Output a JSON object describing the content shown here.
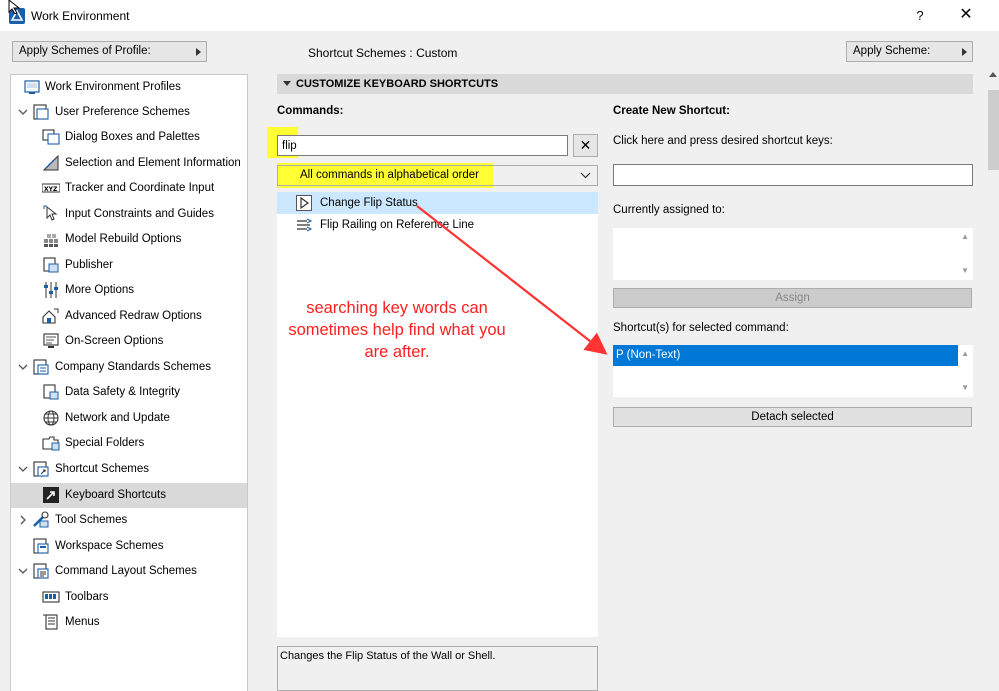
{
  "window": {
    "title": "Work Environment",
    "help": "?",
    "close": "✕"
  },
  "topbar": {
    "profile_button": "Apply Schemes of Profile:",
    "scheme_label": "Shortcut Schemes :",
    "scheme_value": "Custom",
    "apply_scheme_button": "Apply Scheme:"
  },
  "tree": {
    "items": [
      {
        "label": "Work Environment Profiles",
        "icon": "profiles-icon",
        "level": 0
      },
      {
        "label": "User Preference Schemes",
        "icon": "user-preference-icon",
        "level": 0,
        "expanded": true
      },
      {
        "label": "Dialog Boxes and Palettes",
        "icon": "dialog-boxes-icon",
        "level": 1
      },
      {
        "label": "Selection and Element Information",
        "icon": "selection-icon",
        "level": 1
      },
      {
        "label": "Tracker and Coordinate Input",
        "icon": "xyz-tracker-icon",
        "level": 1
      },
      {
        "label": "Input Constraints and Guides",
        "icon": "input-constraints-icon",
        "level": 1
      },
      {
        "label": "Model Rebuild Options",
        "icon": "model-rebuild-icon",
        "level": 1
      },
      {
        "label": "Publisher",
        "icon": "publisher-icon",
        "level": 1
      },
      {
        "label": "More Options",
        "icon": "more-options-icon",
        "level": 1
      },
      {
        "label": "Advanced Redraw Options",
        "icon": "advanced-redraw-icon",
        "level": 1
      },
      {
        "label": "On-Screen Options",
        "icon": "on-screen-icon",
        "level": 1
      },
      {
        "label": "Company Standards Schemes",
        "icon": "company-standards-icon",
        "level": 0,
        "expanded": true
      },
      {
        "label": "Data Safety & Integrity",
        "icon": "data-safety-icon",
        "level": 1
      },
      {
        "label": "Network and Update",
        "icon": "network-globe-icon",
        "level": 1
      },
      {
        "label": "Special Folders",
        "icon": "special-folders-icon",
        "level": 1
      },
      {
        "label": "Shortcut Schemes",
        "icon": "shortcut-schemes-icon",
        "level": 0,
        "expanded": true
      },
      {
        "label": "Keyboard Shortcuts",
        "icon": "keyboard-shortcuts-icon",
        "level": 1,
        "selected": true
      },
      {
        "label": "Tool Schemes",
        "icon": "tool-schemes-icon",
        "level": 0,
        "expanded": false
      },
      {
        "label": "Workspace Schemes",
        "icon": "workspace-schemes-icon",
        "level": 0
      },
      {
        "label": "Command Layout Schemes",
        "icon": "command-layout-icon",
        "level": 0,
        "expanded": true
      },
      {
        "label": "Toolbars",
        "icon": "toolbars-icon",
        "level": 1
      },
      {
        "label": "Menus",
        "icon": "menus-icon",
        "level": 1
      }
    ]
  },
  "main": {
    "section_title": "CUSTOMIZE KEYBOARD SHORTCUTS",
    "commands_label": "Commands:",
    "search_value": "flip",
    "clear_button": "✕",
    "order_value": "All commands in alphabetical order",
    "commands": [
      {
        "label": "Change Flip Status",
        "icon": "play-triangle-icon",
        "selected": true
      },
      {
        "label": "Flip Railing on Reference Line",
        "icon": "railing-icon",
        "selected": false
      }
    ],
    "description": "Changes the Flip Status of the Wall or Shell.",
    "annotation": "searching key words can sometimes help find what you are after."
  },
  "right": {
    "create_label": "Create New Shortcut:",
    "press_label": "Click here and press desired shortcut keys:",
    "shortcut_value": "",
    "assigned_label": "Currently assigned to:",
    "assign_button": "Assign",
    "for_selected_label": "Shortcut(s) for selected command:",
    "shortcuts": [
      "P (Non-Text)"
    ],
    "detach_button": "Detach selected"
  },
  "colors": {
    "selection": "#0078d7",
    "highlight": "#ffff33",
    "annotation": "#ff1f1f",
    "list_selected": "#cce8ff"
  }
}
